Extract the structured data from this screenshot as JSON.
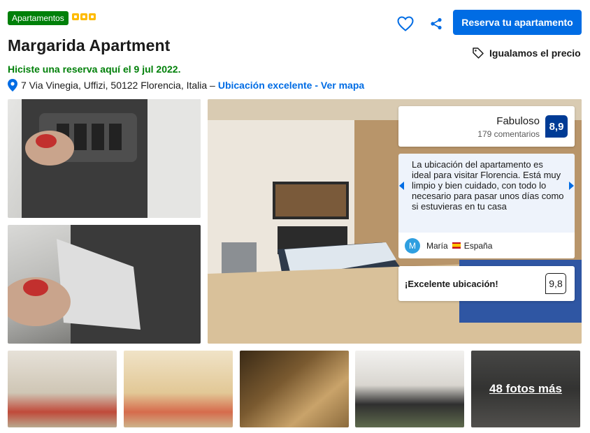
{
  "header": {
    "property_type": "Apartamentos",
    "stars": 3,
    "title": "Margarida Apartment",
    "booked_notice": "Hiciste una reserva aquí el 9 jul 2022.",
    "address": "7 Via Vinegia, Uffizi, 50122 Florencia, Italia –",
    "location_link": "Ubicación excelente - Ver mapa",
    "reserve_button": "Reserva tu apartamento",
    "price_match": "Igualamos el precio"
  },
  "rating": {
    "label": "Fabuloso",
    "reviews": "179 comentarios",
    "score": "8,9"
  },
  "review": {
    "text": "La ubicación del apartamento es ideal para visitar Florencia. Está muy limpio y bien cuidado, con todo lo necesario para pasar unos días como si estuvieras en tu casa",
    "author_initial": "M",
    "author": "María",
    "country": "España"
  },
  "location_score": {
    "label": "¡Excelente ubicación!",
    "score": "9,8"
  },
  "gallery": {
    "more_photos": "48 fotos más"
  },
  "colors": {
    "brand_blue": "#006ce4",
    "dark_blue": "#003b95",
    "green": "#008009",
    "star_yellow": "#febb02"
  },
  "icons": [
    "heart-icon",
    "share-icon",
    "map-pin-icon",
    "price-tag-icon",
    "chevron-left-icon",
    "chevron-right-icon"
  ]
}
